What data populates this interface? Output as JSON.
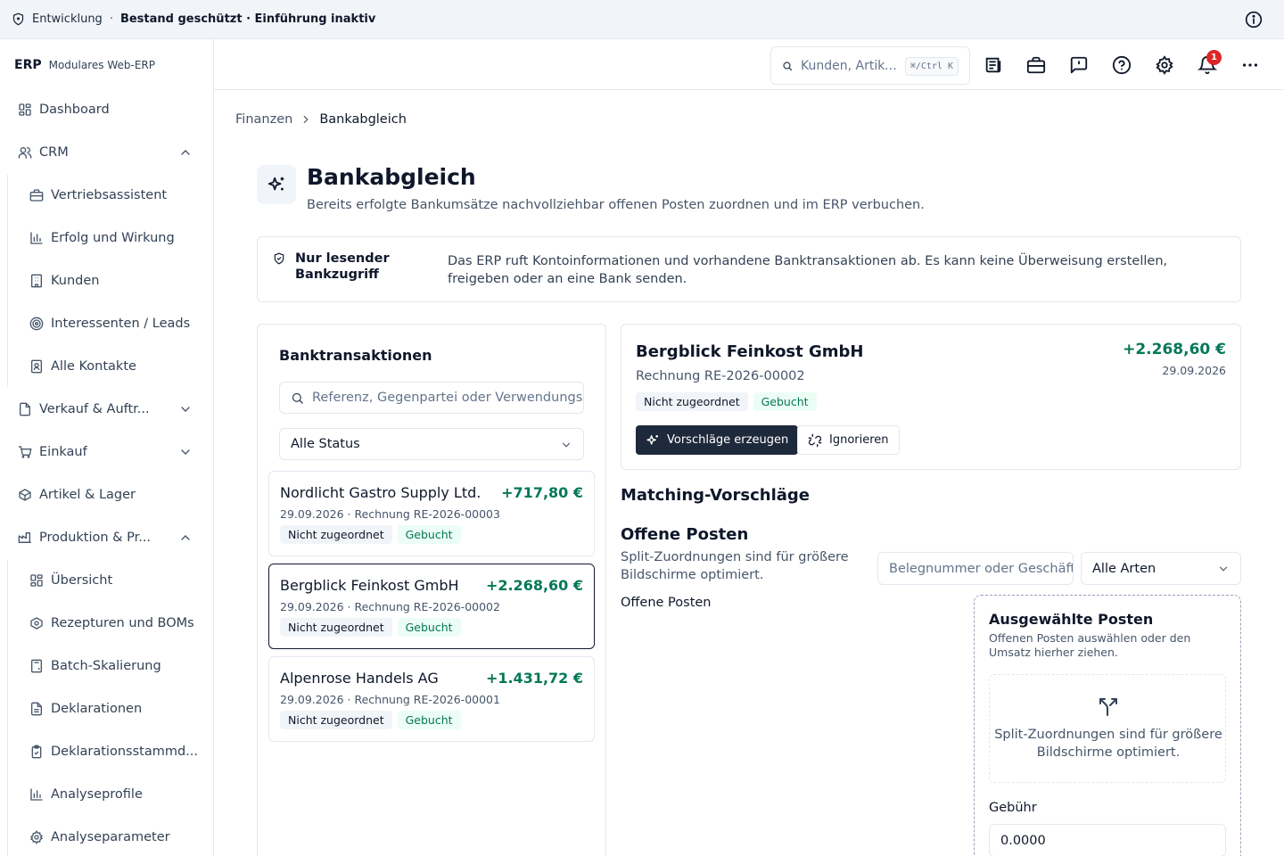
{
  "banner": {
    "env": "Entwicklung",
    "separator": "·",
    "status": "Bestand geschützt · Einführung inaktiv"
  },
  "brand": {
    "logo": "ERP",
    "subtitle": "Modulares Web-ERP"
  },
  "sidebar": {
    "items": [
      {
        "label": "Dashboard",
        "icon": "dashboard-icon"
      },
      {
        "label": "CRM",
        "icon": "users-icon",
        "expanded": true
      },
      {
        "label": "Vertriebsassistent",
        "icon": "briefcase-icon"
      },
      {
        "label": "Erfolg und Wirkung",
        "icon": "bar-chart-icon"
      },
      {
        "label": "Kunden",
        "icon": "building-icon"
      },
      {
        "label": "Interessenten / Leads",
        "icon": "target-icon"
      },
      {
        "label": "Alle Kontakte",
        "icon": "contact-icon"
      },
      {
        "label": "Verkauf & Auftr...",
        "icon": "document-icon",
        "expanded": false
      },
      {
        "label": "Einkauf",
        "icon": "cart-icon",
        "expanded": false
      },
      {
        "label": "Artikel & Lager",
        "icon": "package-icon"
      },
      {
        "label": "Produktion & Pr...",
        "icon": "factory-icon",
        "expanded": true
      },
      {
        "label": "Übersicht",
        "icon": "dashboard-icon"
      },
      {
        "label": "Rezepturen und BOMs",
        "icon": "flask-icon"
      },
      {
        "label": "Batch-Skalierung",
        "icon": "calculator-icon"
      },
      {
        "label": "Deklarationen",
        "icon": "file-text-icon"
      },
      {
        "label": "Deklarationsstammd...",
        "icon": "clipboard-icon"
      },
      {
        "label": "Analyseprofile",
        "icon": "bar-chart-icon"
      },
      {
        "label": "Analyseparameter",
        "icon": "gear-icon"
      }
    ]
  },
  "header": {
    "search_placeholder": "Kunden, Artikel, Belege …",
    "shortcut": "⌘/Ctrl K",
    "notification_count": "1"
  },
  "breadcrumb": {
    "parent": "Finanzen",
    "current": "Bankabgleich"
  },
  "page": {
    "title": "Bankabgleich",
    "subtitle": "Bereits erfolgte Bankumsätze nachvollziehbar offenen Posten zuordnen und im ERP verbuchen."
  },
  "notice": {
    "title": "Nur lesender Bankzugriff",
    "text": "Das ERP ruft Kontoinformationen und vorhandene Banktransaktionen ab. Es kann keine Überweisung erstellen, freigeben oder an eine Bank senden."
  },
  "transactions": {
    "title": "Banktransaktionen",
    "search_placeholder": "Referenz, Gegenpartei oder Verwendungszweck",
    "status_filter": "Alle Status",
    "items": [
      {
        "name": "Nordlicht Gastro Supply Ltd.",
        "amount": "+717,80 €",
        "meta": "29.09.2026 · Rechnung RE-2026-00003",
        "tag1": "Nicht zugeordnet",
        "tag2": "Gebucht"
      },
      {
        "name": "Bergblick Feinkost GmbH",
        "amount": "+2.268,60 €",
        "meta": "29.09.2026 · Rechnung RE-2026-00002",
        "tag1": "Nicht zugeordnet",
        "tag2": "Gebucht"
      },
      {
        "name": "Alpenrose Handels AG",
        "amount": "+1.431,72 €",
        "meta": "29.09.2026 · Rechnung RE-2026-00001",
        "tag1": "Nicht zugeordnet",
        "tag2": "Gebucht"
      }
    ]
  },
  "detail": {
    "name": "Bergblick Feinkost GmbH",
    "reference": "Rechnung RE-2026-00002",
    "amount": "+2.268,60 €",
    "date": "29.09.2026",
    "tag1": "Nicht zugeordnet",
    "tag2": "Gebucht",
    "primary_button": "Vorschläge erzeugen",
    "secondary_button": "Ignorieren"
  },
  "matching": {
    "title": "Matching-Vorschläge"
  },
  "open_items": {
    "title": "Offene Posten",
    "hint": "Split-Zuordnungen sind für größere Bildschirme optimiert.",
    "label": "Offene Posten",
    "search_placeholder": "Belegnummer oder Geschäftspartner",
    "type_filter": "Alle Arten"
  },
  "selected": {
    "title": "Ausgewählte Posten",
    "description": "Offenen Posten auswählen oder den Umsatz hierher ziehen.",
    "info": "Split-Zuordnungen sind für größere Bildschirme optimiert.",
    "fee_label": "Gebühr",
    "fee_value": "0.0000"
  },
  "colors": {
    "accent": "#1e293b",
    "positive": "#047857",
    "badge": "#dc2626"
  }
}
